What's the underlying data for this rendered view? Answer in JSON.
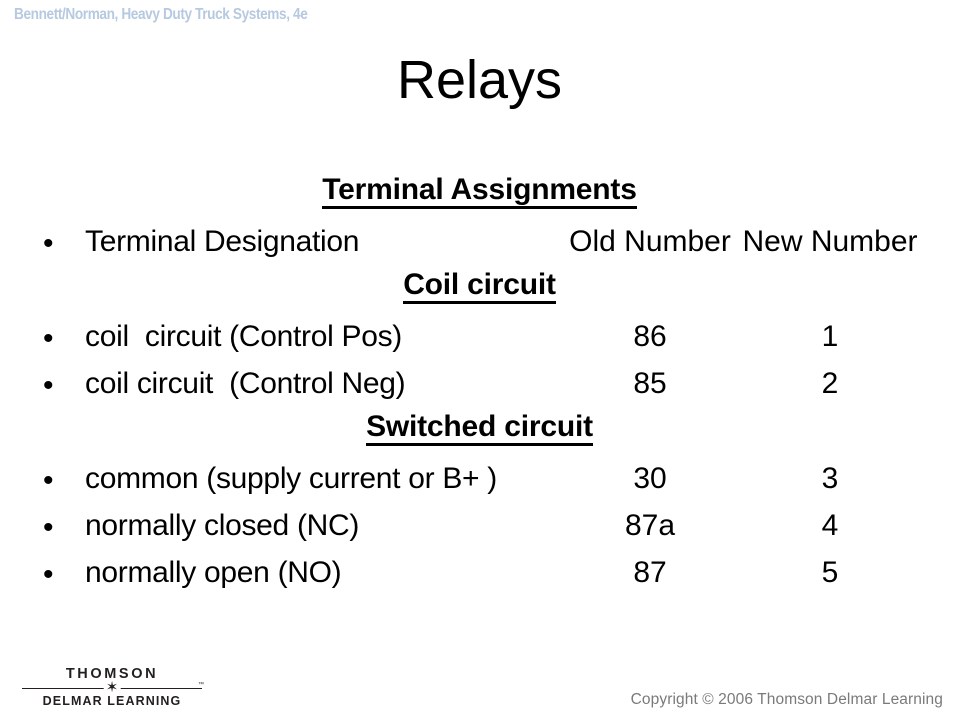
{
  "header": {
    "text": "Bennett/Norman, Heavy Duty Truck Systems, 4e",
    "color": "#b6c9e0"
  },
  "title": "Relays",
  "content": {
    "section_title": "Terminal Assignments",
    "column_header": {
      "designation": "Terminal Designation",
      "old_number": "Old Number",
      "new_number": "New Number"
    },
    "coil_section_title": "Coil circuit",
    "coil_rows": [
      {
        "bullet": "•",
        "label": "coil  circuit (Control Pos)",
        "old": "86",
        "new": "1"
      },
      {
        "bullet": "•",
        "label": "coil circuit  (Control Neg)",
        "old": "85",
        "new": "2"
      }
    ],
    "switched_section_title": "Switched circuit",
    "switched_rows": [
      {
        "bullet": "•",
        "label": "common (supply current or B+ )",
        "old": "30",
        "new": "3"
      },
      {
        "bullet": "•",
        "label": "normally closed (NC)",
        "old": "87a",
        "new": "4"
      },
      {
        "bullet": "•",
        "label": "normally open (NO)",
        "old": "87",
        "new": "5"
      }
    ],
    "header_bullet": "•"
  },
  "footer": {
    "logo_top": "THOMSON",
    "logo_bottom": "DELMAR LEARNING",
    "logo_star": "✶",
    "logo_tm": "™",
    "copyright": "Copyright © 2006 Thomson Delmar Learning",
    "copyright_color": "#7a7a7a"
  }
}
